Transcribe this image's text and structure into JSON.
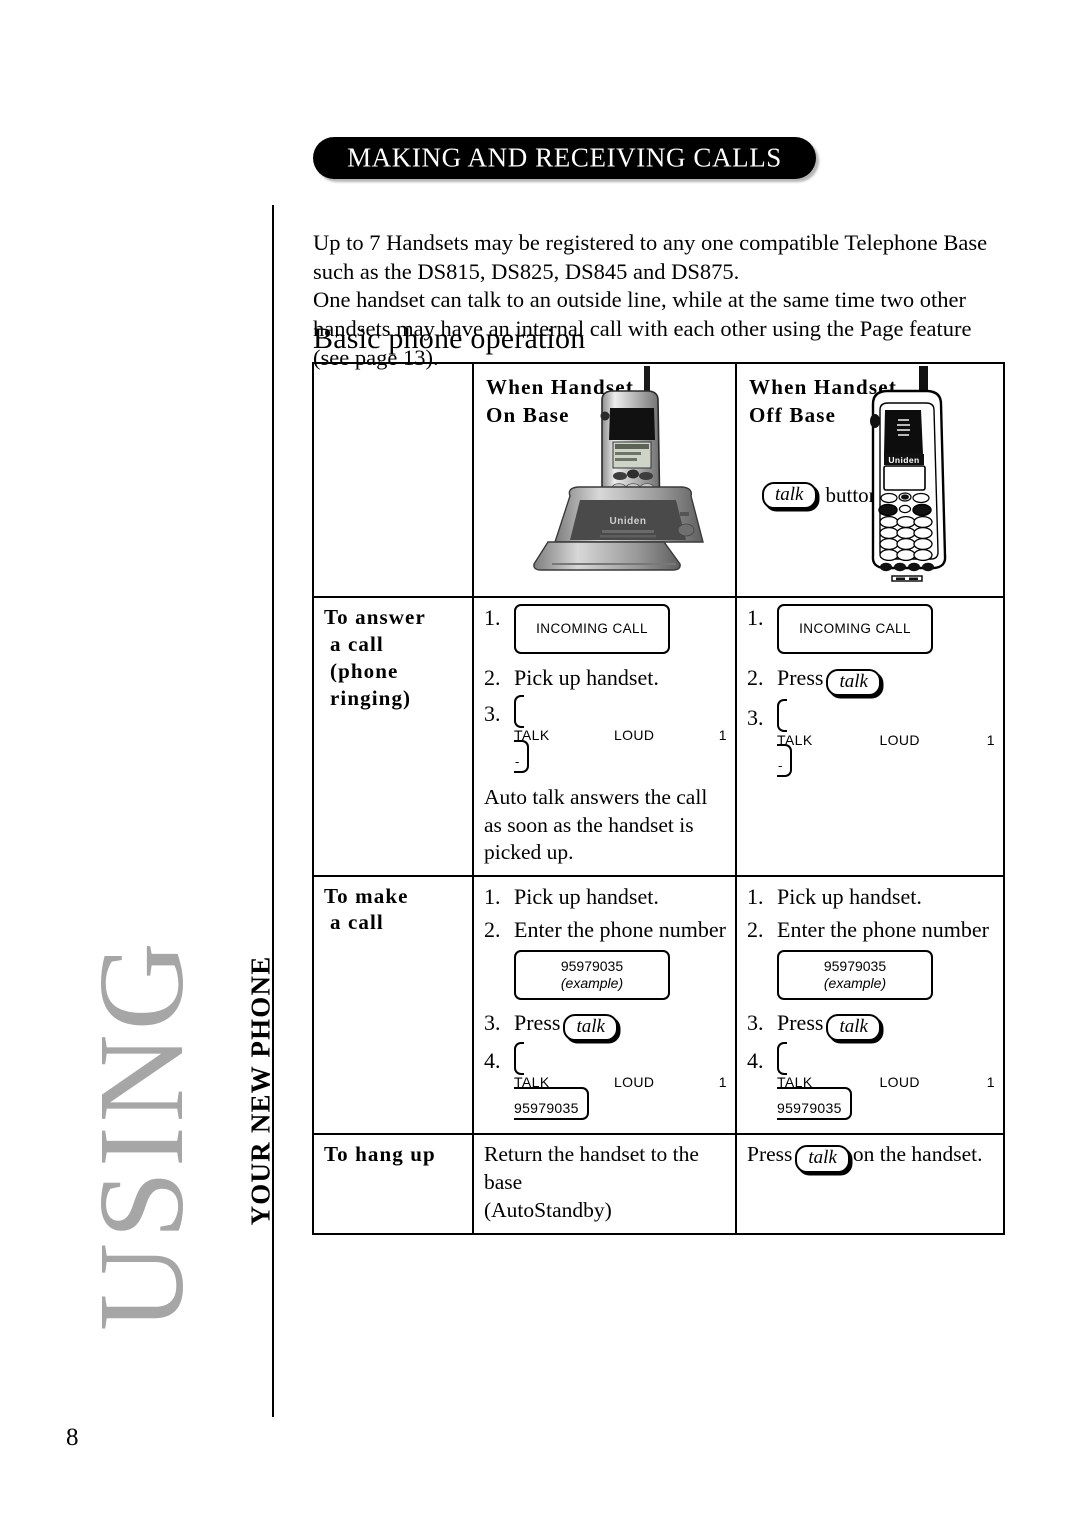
{
  "page": {
    "number": "8",
    "side_tab_main": "USING",
    "side_tab_sub": "YOUR NEW PHONE"
  },
  "header": {
    "banner_title": "MAKING AND RECEIVING CALLS"
  },
  "intro": {
    "paragraph_1": "Up to 7 Handsets may be registered to any one compatible Telephone Base such as the DS815, DS825, DS845 and DS875.",
    "paragraph_2": "One handset can talk to an outside line, while at the same time two other handsets may have an internal call with each other using the Page feature (see page 13)."
  },
  "section": {
    "heading": "Basic phone operation"
  },
  "table": {
    "column_headers": {
      "blank": "",
      "on_base": "When Handset\nOn Base",
      "on_base_line1": "When Handset",
      "on_base_line2": "On Base",
      "off_base_line1": "When Handset",
      "off_base_line2": "Off Base"
    },
    "talk_button_label": "talk",
    "talk_button_note": "button",
    "rows": [
      {
        "label_line1": "To answer",
        "label_line2": "a call",
        "label_line3": "(phone ringing)",
        "on_base": {
          "step1_num": "1.",
          "step1_lcd": "INCOMING CALL",
          "step2_num": "2.",
          "step2_text": "Pick up handset.",
          "step3_num": "3.",
          "step3_lcd_left": "TALK",
          "step3_lcd_mid": "LOUD",
          "step3_lcd_right": "1",
          "step3_lcd_dash": "-",
          "note": "Auto talk answers the call as soon as the handset is picked up."
        },
        "off_base": {
          "step1_num": "1.",
          "step1_lcd": "INCOMING CALL",
          "step2_num": "2.",
          "step2_text_before": "Press",
          "step2_button": "talk",
          "step3_num": "3.",
          "step3_lcd_left": "TALK",
          "step3_lcd_mid": "LOUD",
          "step3_lcd_right": "1",
          "step3_lcd_dash": "-"
        }
      },
      {
        "label_line1": "To make",
        "label_line2": "a call",
        "on_base": {
          "step1_num": "1.",
          "step1_text": "Pick up handset.",
          "step2_num": "2.",
          "step2_text": "Enter the phone number",
          "step2_lcd_number": "95979035",
          "step2_lcd_example": "(example)",
          "step3_num": "3.",
          "step3_text_before": "Press",
          "step3_button": "talk",
          "step4_num": "4.",
          "step4_lcd_left": "TALK",
          "step4_lcd_mid": "LOUD",
          "step4_lcd_right": "1",
          "step4_lcd_number": "95979035"
        },
        "off_base": {
          "step1_num": "1.",
          "step1_text": "Pick up handset.",
          "step2_num": "2.",
          "step2_text": "Enter the phone number",
          "step2_lcd_number": "95979035",
          "step2_lcd_example": "(example)",
          "step3_num": "3.",
          "step3_text_before": "Press",
          "step3_button": "talk",
          "step4_num": "4.",
          "step4_lcd_left": "TALK",
          "step4_lcd_mid": "LOUD",
          "step4_lcd_right": "1",
          "step4_lcd_number": "95979035"
        }
      },
      {
        "label_line1": "To hang up",
        "on_base": {
          "text_line1": "Return the handset to the base",
          "text_line2": "(AutoStandby)"
        },
        "off_base": {
          "text_before": "Press",
          "button": "talk",
          "text_after": "on the handset."
        }
      }
    ]
  },
  "artwork": {
    "base_photo_caption": "Uniden",
    "handset_brand": "Uniden"
  }
}
